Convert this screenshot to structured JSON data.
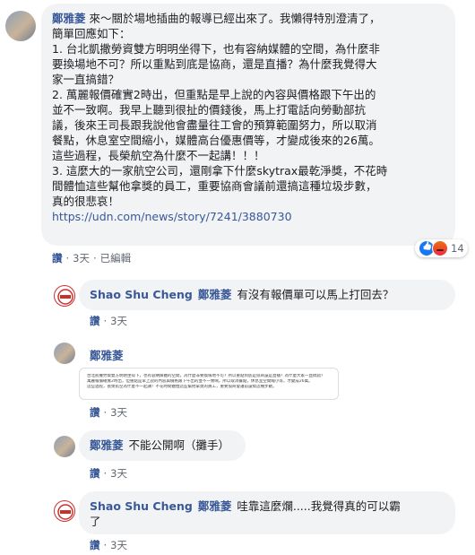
{
  "main_comment": {
    "author": "鄭雅菱",
    "lines": [
      "來～關於場地插曲的報導已經出來了。我懶得特別澄清了，",
      "簡單回應如下：",
      "1. 台北凱撒勞資雙方明明坐得下，也有容納媒體的空間，為什麼非",
      "要換場地不可？所以重點到底是協商，還是直播？為什麼我覺得大",
      "家一直搞錯？",
      "2. 萬麗報價確實2時出，但重點是早上說的內容與價格跟下午出的",
      "並不一致啊。我早上聽到很扯的價錢後，馬上打電話向勞動部抗",
      "議，後來王司長跟我說他會盡量往工會的預算範圍努力，所以取消",
      "餐點，休息室空間縮小，媒體高台優惠價等，才變成後來的26萬。",
      "這些過程，長榮航空為什麼不一起講！！！",
      "3. 這麼大的一家航空公司，還剛拿下什麼skytrax最乾淨獎，不花時",
      "間體恤這些幫他拿獎的員工，重要協商會議前還搞這種垃圾步數，",
      "真的很悲哀！"
    ],
    "link": "https://udn.com/news/story/7241/3880730",
    "actions": {
      "like": "讚",
      "time": "3天",
      "edited": "已編輯"
    },
    "reaction_count": "14"
  },
  "replies": [
    {
      "author": "Shao Shu Cheng",
      "tag": "鄭雅菱",
      "text": "有沒有報價單可以馬上打回去？",
      "text2": "",
      "like": "讚",
      "time": "3天"
    },
    {
      "author": "鄭雅菱",
      "tag": "",
      "text": "",
      "text2": "",
      "like": "讚",
      "time": "3天",
      "attachment_lines": [
        "台北凱撒勞資雙方明明坐得下，也有容納媒體的空間，為什麼非要換場地不可？所以重點到底是協商還是直播？為什麼大家一直搞錯？",
        "萬麗報價確實2時出，但重點是早上說的內容與價格跟下午出的並不一致啊。所以取消餐點，休息室空間縮小等，才變成26萬。",
        "這些過程，長榮航空為什麼不一起講！不花時間體恤這些幫他拿獎的員工，重要協商會議前還搞這種步數。"
      ]
    },
    {
      "author": "鄭雅菱",
      "tag": "",
      "text": "不能公開啊（攤手）",
      "text2": "",
      "like": "讚",
      "time": "3天"
    },
    {
      "author": "Shao Shu Cheng",
      "tag": "鄭雅菱",
      "text": "哇靠這麼爛.....我覺得真的可以霸",
      "text2": "了",
      "like": "讚",
      "time": "3天"
    }
  ],
  "colors": {
    "name": "#385898",
    "bubble": "#f2f3f5",
    "meta": "#606770",
    "like": "#1877f2"
  }
}
